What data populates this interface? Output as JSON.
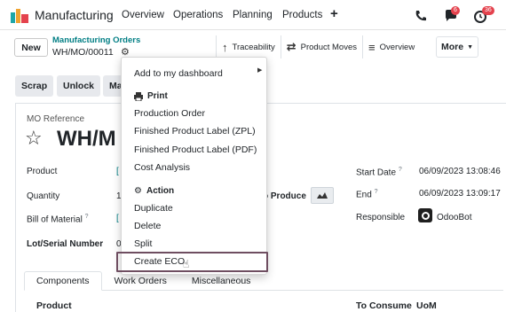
{
  "navbar": {
    "app_name": "Manufacturing",
    "menus": [
      "Overview",
      "Operations",
      "Planning",
      "Products"
    ],
    "plus_label": "+",
    "icons": [
      "phone-icon",
      "chat-icon",
      "activity-clock-icon"
    ],
    "chat_badge": "6",
    "activity_badge": "36"
  },
  "control": {
    "new_label": "New",
    "breadcrumb": "Manufacturing Orders",
    "record_name": "WH/MO/00011",
    "smart_buttons": [
      "Traceability",
      "Product Moves",
      "Overview"
    ],
    "more_label": "More"
  },
  "actions": {
    "buttons": [
      "Scrap",
      "Unlock",
      "Ma"
    ]
  },
  "form": {
    "mo_ref_label": "MO Reference",
    "title": "WH/M",
    "product_label": "Product",
    "product_value": "[",
    "quantity_label": "Quantity",
    "quantity_value": "1",
    "to_produce_label": "o Produce",
    "bom_label": "Bill of Material",
    "bom_value": "[",
    "lot_label": "Lot/Serial Number",
    "lot_value": "0",
    "start_date_label": "Start Date",
    "start_date_value": "06/09/2023 13:08:46",
    "end_label": "End",
    "end_value": "06/09/2023 13:09:17",
    "responsible_label": "Responsible",
    "responsible_value": "OdooBot",
    "help_mark": "?"
  },
  "tabs": [
    "Components",
    "Work Orders",
    "Miscellaneous"
  ],
  "table": {
    "col_product": "Product",
    "col_to_consume": "To Consume",
    "col_uom": "UoM"
  },
  "dropdown": {
    "dashboard": "Add to my dashboard",
    "print_header": "Print",
    "print_items": [
      "Production Order",
      "Finished Product Label (ZPL)",
      "Finished Product Label (PDF)",
      "Cost Analysis"
    ],
    "action_header": "Action",
    "action_items": [
      "Duplicate",
      "Delete",
      "Split",
      "Create ECO"
    ]
  },
  "colors": {
    "accent": "#017e84",
    "badge": "#e4424d",
    "highlight_border": "#6f4e61"
  }
}
